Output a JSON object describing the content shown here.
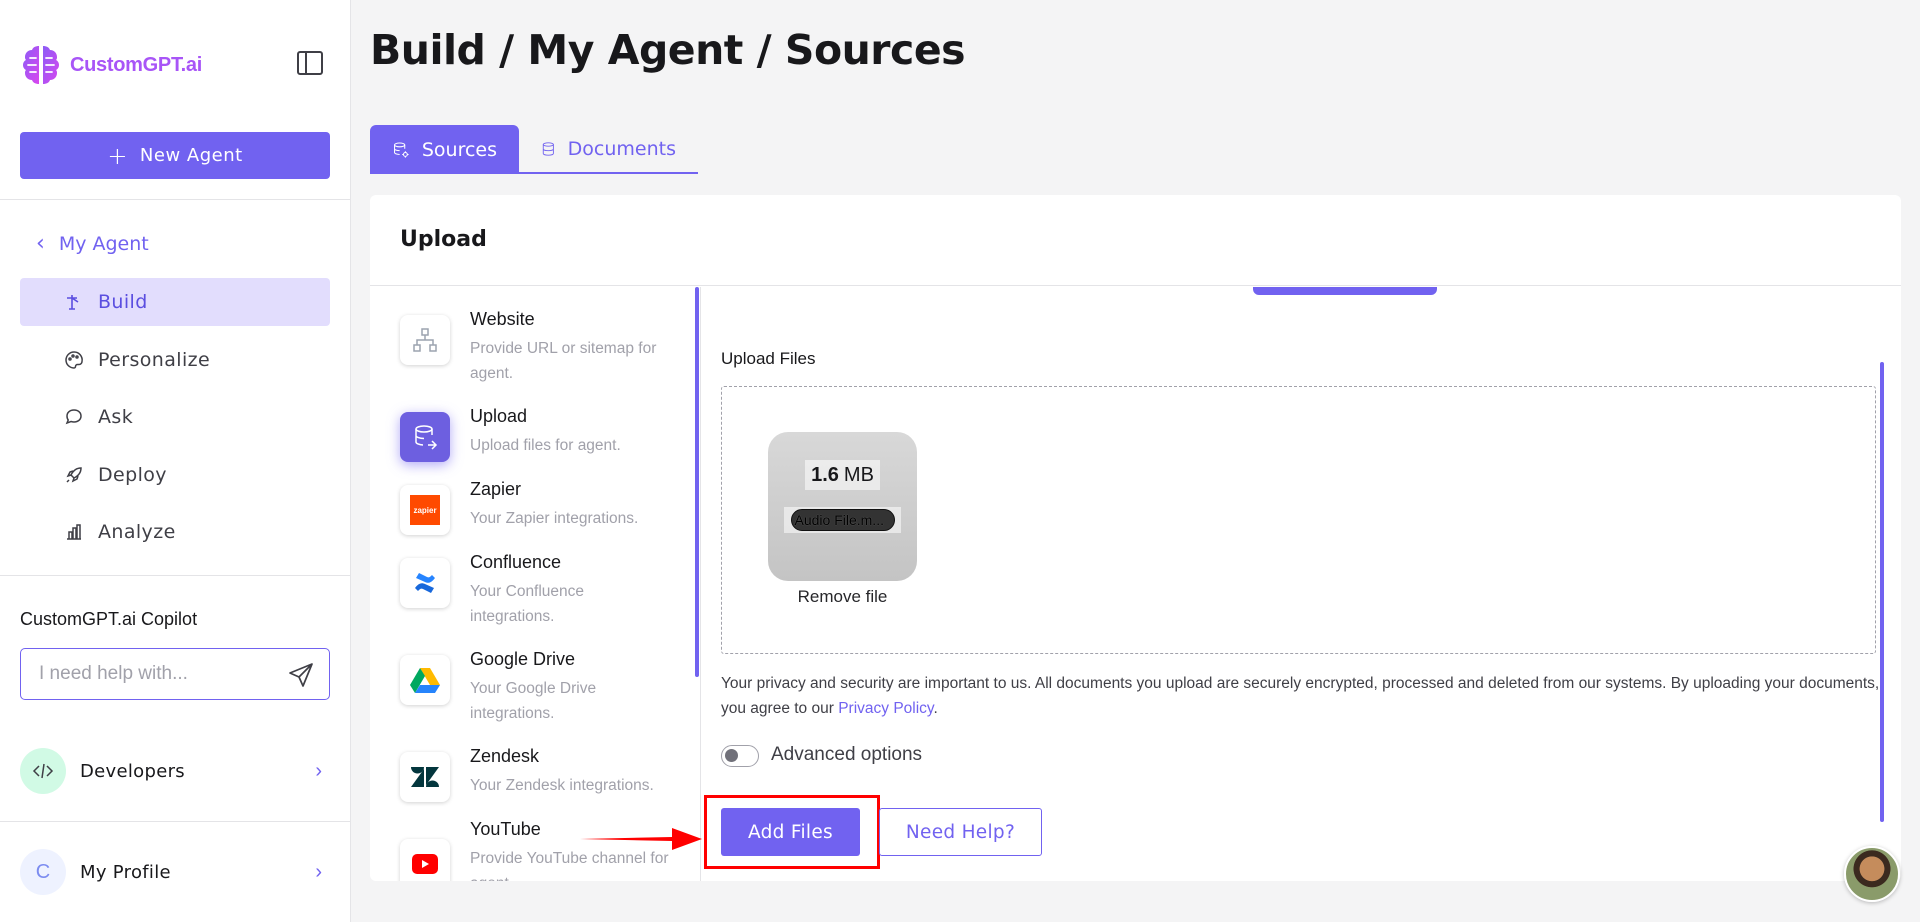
{
  "sidebar": {
    "brand": "CustomGPT.ai",
    "new_agent_label": "New Agent",
    "back_label": "My Agent",
    "nav": [
      {
        "label": "Build",
        "icon": "build-icon",
        "active": true
      },
      {
        "label": "Personalize",
        "icon": "palette-icon",
        "active": false
      },
      {
        "label": "Ask",
        "icon": "chat-icon",
        "active": false
      },
      {
        "label": "Deploy",
        "icon": "rocket-icon",
        "active": false
      },
      {
        "label": "Analyze",
        "icon": "chart-icon",
        "active": false
      }
    ],
    "copilot_title": "CustomGPT.ai Copilot",
    "copilot_placeholder": "I need help with...",
    "developers_label": "Developers",
    "profile_label": "My Profile",
    "profile_initial": "C"
  },
  "page": {
    "title": "Build / My Agent / Sources",
    "tabs": [
      {
        "label": "Sources",
        "active": true
      },
      {
        "label": "Documents",
        "active": false
      }
    ]
  },
  "card": {
    "title": "Upload",
    "sources": [
      {
        "name": "Website",
        "desc": "Provide URL or sitemap for agent."
      },
      {
        "name": "Upload",
        "desc": "Upload files for agent."
      },
      {
        "name": "Zapier",
        "desc": "Your Zapier integrations.",
        "icon_text": "zapier"
      },
      {
        "name": "Confluence",
        "desc": "Your Confluence integrations."
      },
      {
        "name": "Google Drive",
        "desc": "Your Google Drive integrations."
      },
      {
        "name": "Zendesk",
        "desc": "Your Zendesk integrations."
      },
      {
        "name": "YouTube",
        "desc": "Provide YouTube channel for agent."
      }
    ],
    "upload_files_label": "Upload Files",
    "file": {
      "size_value": "1.6",
      "size_unit": "MB",
      "name": "Audio File.m...",
      "remove_label": "Remove file"
    },
    "privacy_text": "Your privacy and security are important to us. All documents you upload are securely encrypted, processed and deleted from our systems. By uploading your documents, you agree to our ",
    "privacy_link": "Privacy Policy",
    "privacy_end": ".",
    "advanced_label": "Advanced options",
    "add_files_label": "Add Files",
    "need_help_label": "Need Help?"
  },
  "colors": {
    "accent": "#7162f0",
    "active_nav_bg": "#e2ddfd",
    "highlight": "#ff0000"
  }
}
